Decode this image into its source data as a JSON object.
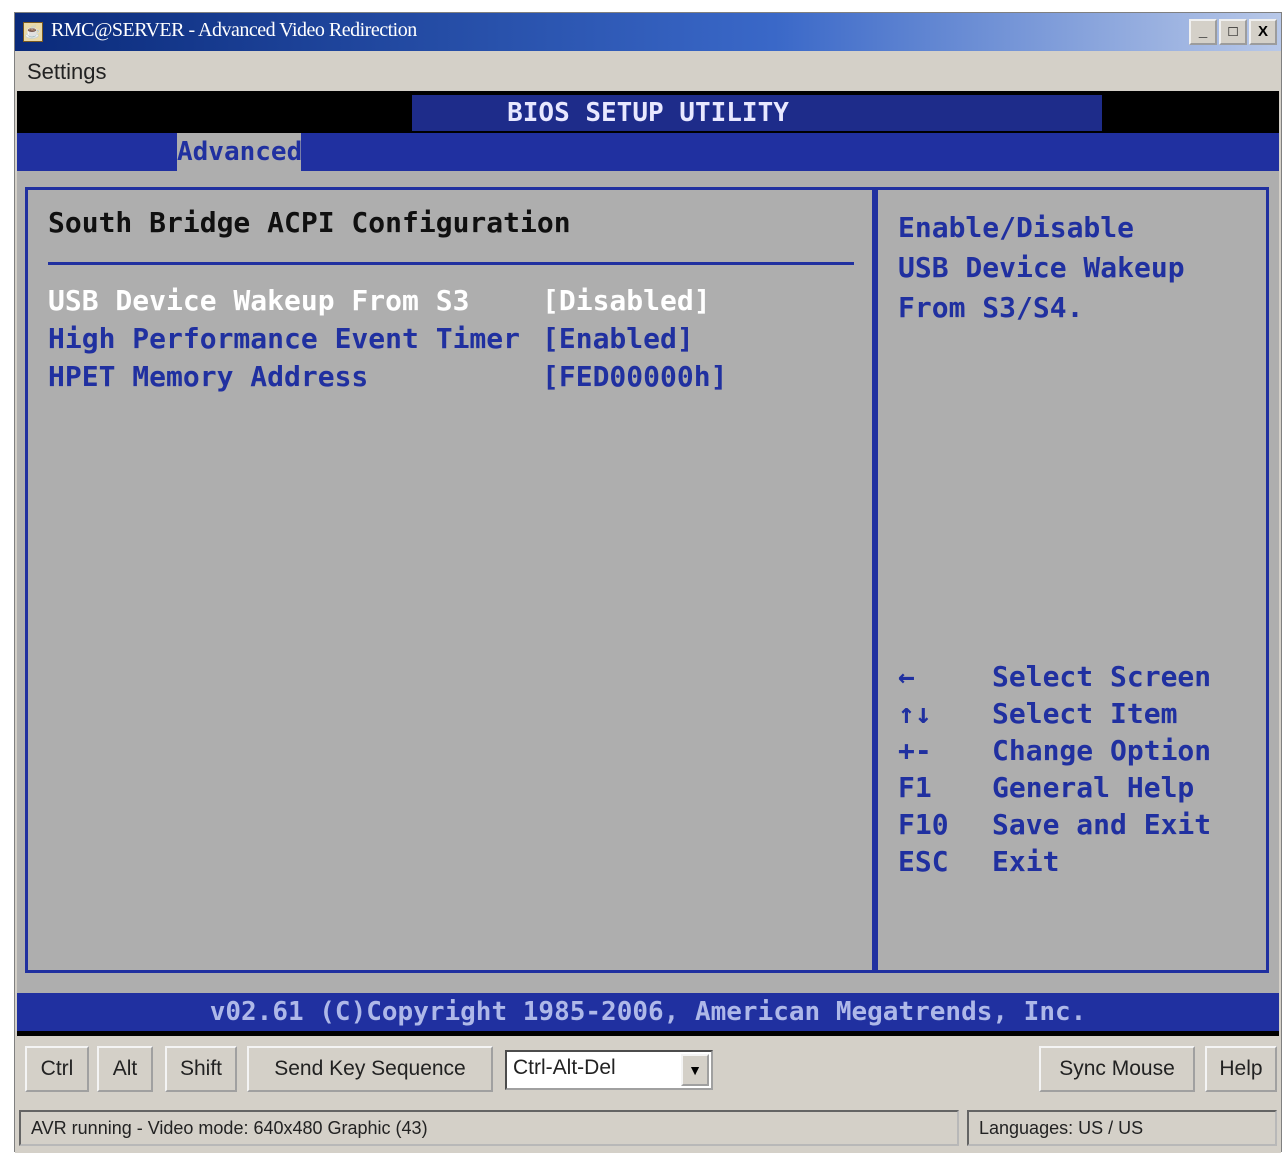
{
  "window": {
    "title": "RMC@SERVER - Advanced Video Redirection",
    "minimize": "_",
    "maximize": "□",
    "close": "X"
  },
  "menu": {
    "settings": "Settings"
  },
  "bios": {
    "title": "BIOS SETUP UTILITY",
    "active_tab": "Advanced",
    "section_heading": "South Bridge ACPI Configuration",
    "options": [
      {
        "label": "USB Device Wakeup From S3",
        "value": "[Disabled]",
        "selected": true
      },
      {
        "label": "High Performance Event Timer",
        "value": "[Enabled]",
        "selected": false
      },
      {
        "label": "HPET Memory Address",
        "value": "[FED00000h]",
        "selected": false
      }
    ],
    "help": [
      "Enable/Disable",
      "USB Device Wakeup",
      "From S3/S4."
    ],
    "keys": [
      {
        "key": "←",
        "desc": "Select Screen"
      },
      {
        "key": "↑↓",
        "desc": "Select Item"
      },
      {
        "key": "+-",
        "desc": "Change Option"
      },
      {
        "key": "F1",
        "desc": "General Help"
      },
      {
        "key": "F10",
        "desc": "Save and Exit"
      },
      {
        "key": "ESC",
        "desc": "Exit"
      }
    ],
    "footer": "v02.61 (C)Copyright 1985-2006, American Megatrends, Inc."
  },
  "toolbar": {
    "ctrl": "Ctrl",
    "alt": "Alt",
    "shift": "Shift",
    "send_key_sequence": "Send Key Sequence",
    "key_sequence_value": "Ctrl-Alt-Del",
    "sync_mouse": "Sync Mouse",
    "help": "Help"
  },
  "status": {
    "left": "AVR running - Video mode: 640x480 Graphic (43)",
    "right": "Languages: US / US"
  },
  "colors": {
    "bios_blue": "#2030a0",
    "bios_gray": "#aeaeae",
    "window_gray": "#d4d0c8"
  }
}
